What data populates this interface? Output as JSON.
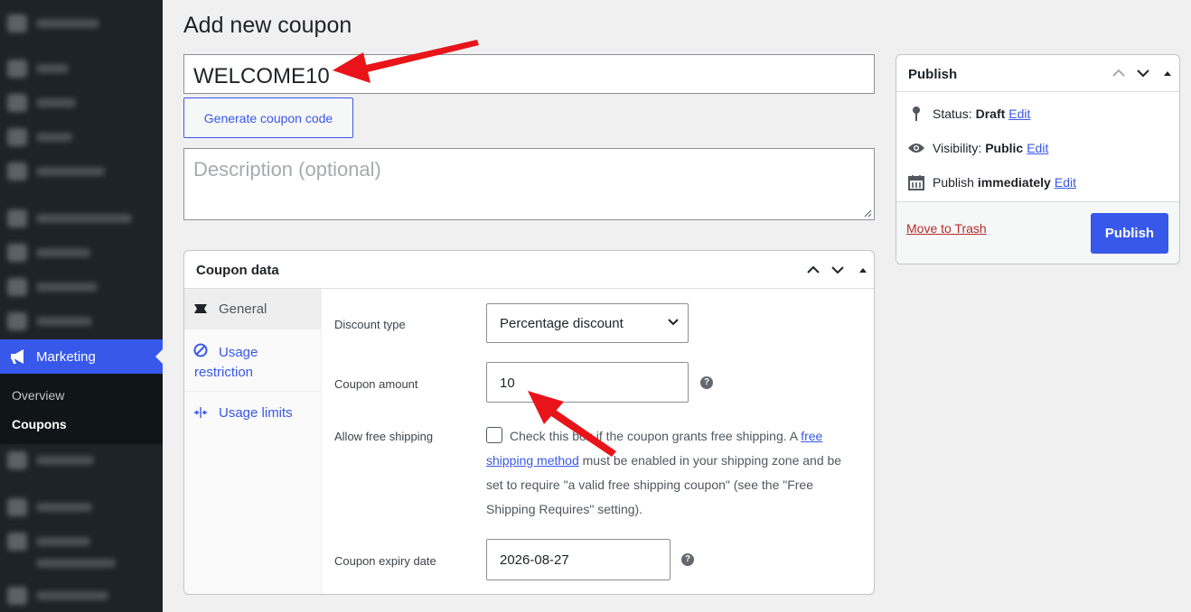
{
  "page": {
    "title": "Add new coupon"
  },
  "sidebar": {
    "active_item": "Marketing",
    "submenu": [
      "Overview",
      "Coupons"
    ],
    "current_submenu": "Coupons"
  },
  "coupon": {
    "code": "WELCOME10",
    "generate_label": "Generate coupon code",
    "description_placeholder": "Description (optional)"
  },
  "coupon_data": {
    "title": "Coupon data",
    "tabs": [
      "General",
      "Usage restriction",
      "Usage limits"
    ],
    "fields": {
      "discount_type_label": "Discount type",
      "discount_type_value": "Percentage discount",
      "amount_label": "Coupon amount",
      "amount_value": "10",
      "free_shipping_label": "Allow free shipping",
      "free_shipping_text_1": "Check this box if the coupon grants free shipping. A ",
      "free_shipping_link": "free shipping method",
      "free_shipping_text_2": " must be enabled in your shipping zone and be set to require \"a valid free shipping coupon\" (see the \"Free Shipping Requires\" setting).",
      "expiry_label": "Coupon expiry date",
      "expiry_value": "2026-08-27"
    }
  },
  "publish": {
    "title": "Publish",
    "status_label": "Status:",
    "status_value": "Draft",
    "visibility_label": "Visibility:",
    "visibility_value": "Public",
    "publish_label": "Publish",
    "publish_value": "immediately",
    "edit_label": "Edit",
    "trash_label": "Move to Trash",
    "button_label": "Publish"
  },
  "colors": {
    "accent": "#3858e9",
    "sidebar": "#1d2327",
    "annotation": "#e8141a"
  }
}
